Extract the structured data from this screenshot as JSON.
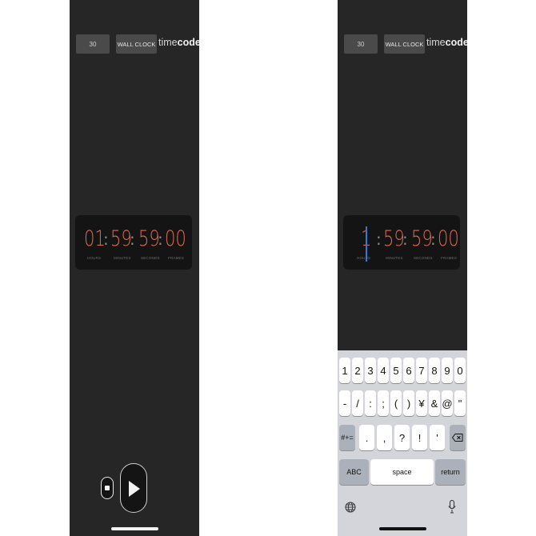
{
  "left_screen": {
    "fps_label": "30",
    "clock_mode_label": "WALL CLOCK",
    "logo": {
      "light": "time",
      "bold": "code"
    },
    "timecode": {
      "hours": "01",
      "minutes": "59",
      "seconds": "59",
      "frames": "00"
    },
    "units": {
      "hours": "HOURS",
      "minutes": "MINUTES",
      "seconds": "SECONDS",
      "frames": "FRAMES"
    },
    "controls": {
      "stop": "stop-icon",
      "play": "play-icon"
    }
  },
  "right_screen": {
    "fps_label": "30",
    "clock_mode_label": "WALL CLOCK",
    "logo": {
      "light": "time",
      "bold": "code"
    },
    "timecode": {
      "hours": "1",
      "minutes": "59",
      "seconds": "59",
      "frames": "00"
    },
    "units": {
      "hours": "HOURS",
      "minutes": "MINUTES",
      "seconds": "SECONDS",
      "frames": "FRAMES"
    },
    "keyboard": {
      "row1": [
        "1",
        "2",
        "3",
        "4",
        "5",
        "6",
        "7",
        "8",
        "9",
        "0"
      ],
      "row2": [
        "-",
        "/",
        ":",
        ";",
        "(",
        ")",
        "¥",
        "&",
        "@",
        "\""
      ],
      "row3_left": "#+=",
      "row3": [
        ".",
        ",",
        "?",
        "!",
        "'"
      ],
      "abc_label": "ABC",
      "space_label": "space",
      "return_label": "return",
      "globe_icon": "globe-icon",
      "mic_icon": "microphone-icon",
      "delete_icon": "delete-icon"
    }
  },
  "colors": {
    "digits": "#dd6a4b",
    "screen_bg": "#262626",
    "panel_bg": "#141414",
    "cursor": "#2f7bd6"
  }
}
